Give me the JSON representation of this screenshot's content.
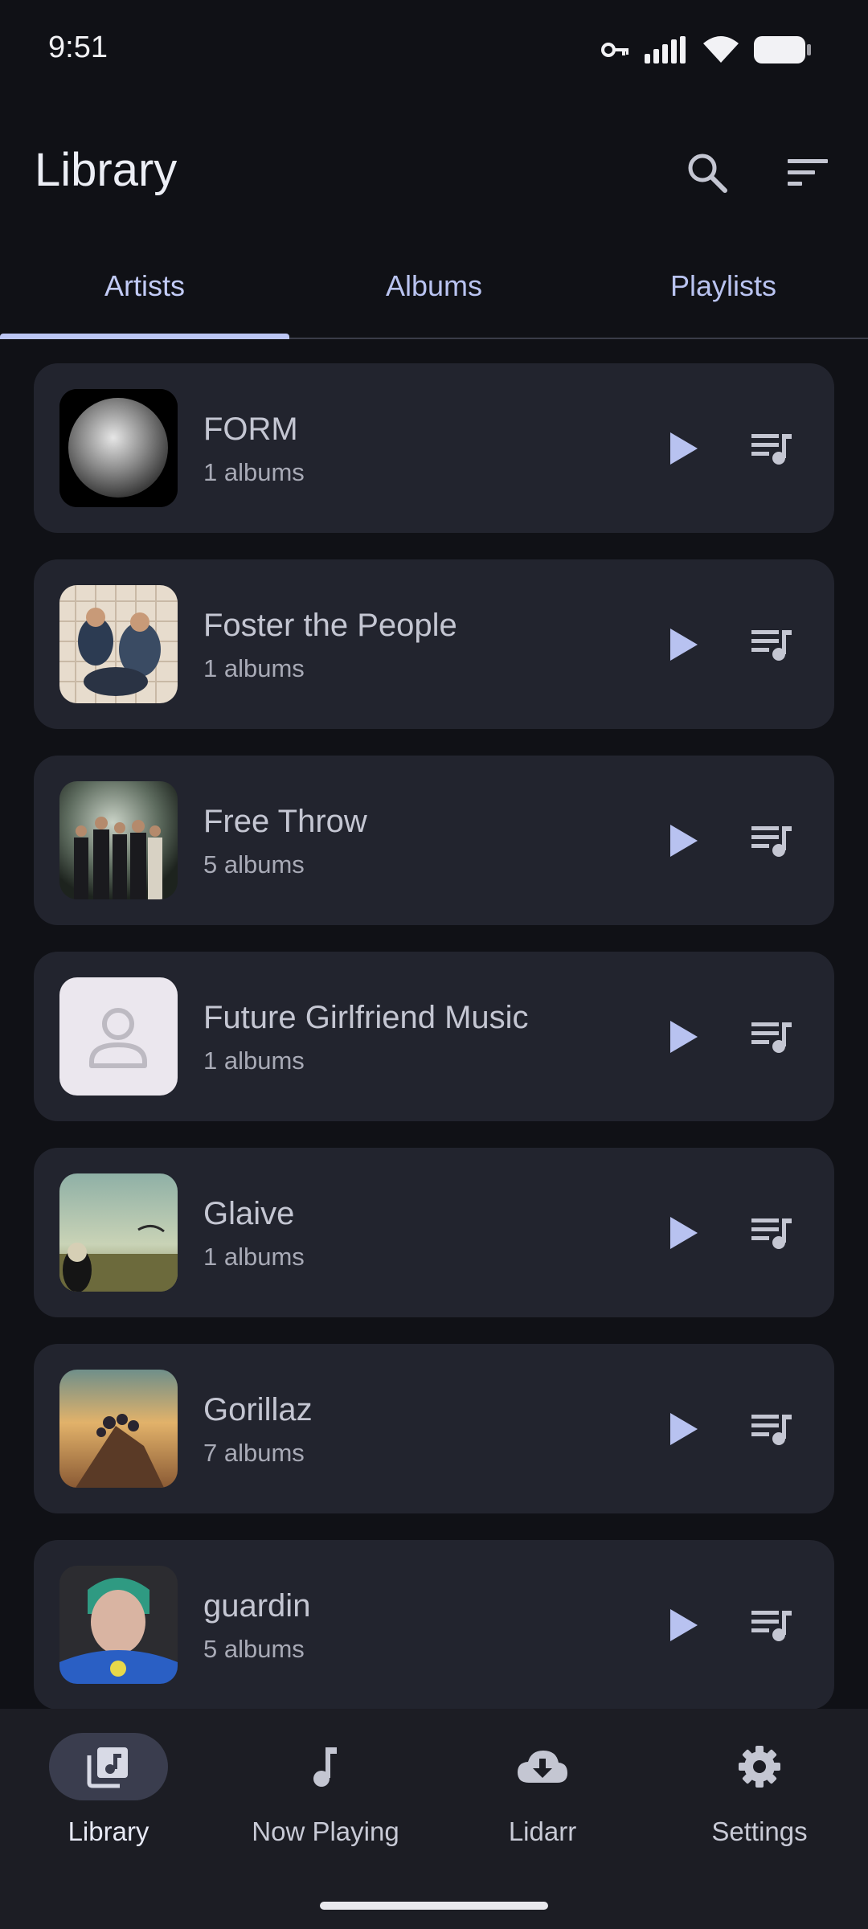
{
  "status": {
    "time": "9:51"
  },
  "header": {
    "title": "Library"
  },
  "tabs": [
    {
      "label": "Artists",
      "active": true
    },
    {
      "label": "Albums",
      "active": false
    },
    {
      "label": "Playlists",
      "active": false
    }
  ],
  "artists": [
    {
      "name": "FORM",
      "albums": "1 albums"
    },
    {
      "name": "Foster the People",
      "albums": "1 albums"
    },
    {
      "name": "Free Throw",
      "albums": "5 albums"
    },
    {
      "name": "Future Girlfriend Music",
      "albums": "1 albums"
    },
    {
      "name": "Glaive",
      "albums": "1 albums"
    },
    {
      "name": "Gorillaz",
      "albums": "7 albums"
    },
    {
      "name": "guardin",
      "albums": "5 albums"
    }
  ],
  "nav": [
    {
      "label": "Library",
      "icon": "library-music-icon",
      "active": true
    },
    {
      "label": "Now Playing",
      "icon": "music-note-icon",
      "active": false
    },
    {
      "label": "Lidarr",
      "icon": "cloud-download-icon",
      "active": false
    },
    {
      "label": "Settings",
      "icon": "gear-icon",
      "active": false
    }
  ],
  "colors": {
    "background": "#101116",
    "card": "#22242e",
    "accent": "#bcc6f4",
    "navBar": "#1c1d24"
  }
}
